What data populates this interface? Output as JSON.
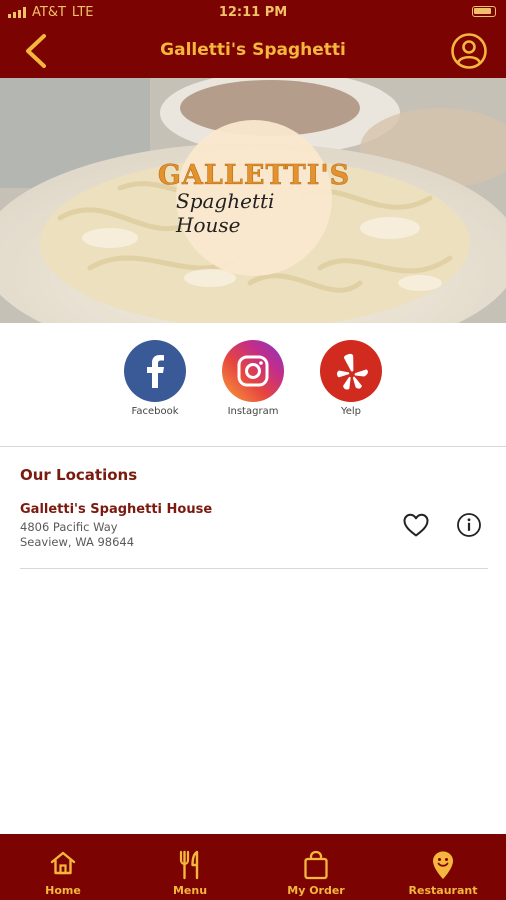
{
  "status_bar": {
    "carrier": "AT&T",
    "network": "LTE",
    "time": "12:11 PM"
  },
  "header": {
    "title": "Galletti's Spaghetti",
    "back_icon": "chevron-left-icon",
    "profile_icon": "user-circle-icon",
    "accent_color": "#7b0402",
    "text_color": "#f4b63c"
  },
  "hero": {
    "logo_text": "GALLETTI'S",
    "logo_subtext": "Spaghetti House"
  },
  "socials": [
    {
      "label": "Facebook",
      "icon": "facebook-icon"
    },
    {
      "label": "Instagram",
      "icon": "instagram-icon"
    },
    {
      "label": "Yelp",
      "icon": "yelp-icon"
    }
  ],
  "locations": {
    "title": "Our Locations",
    "items": [
      {
        "name": "Galletti's Spaghetti House",
        "address_line1": "4806 Pacific Way",
        "address_line2": "Seaview, WA 98644",
        "favorite_icon": "heart-outline-icon",
        "info_icon": "info-circle-icon"
      }
    ]
  },
  "tabs": [
    {
      "label": "Home",
      "icon": "home-icon"
    },
    {
      "label": "Menu",
      "icon": "fork-knife-icon"
    },
    {
      "label": "My Order",
      "icon": "shopping-bag-icon"
    },
    {
      "label": "Restaurant",
      "icon": "location-pin-smile-icon"
    }
  ]
}
